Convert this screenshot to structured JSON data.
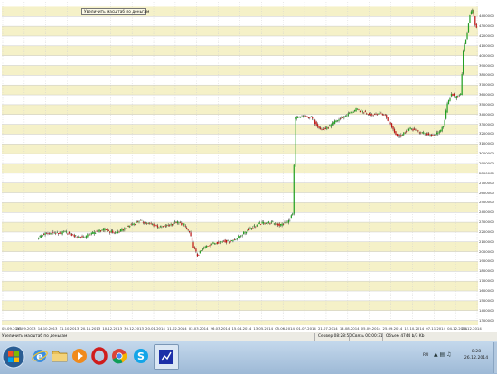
{
  "tooltip": {
    "text": "Увеличить масштаб по деньгам"
  },
  "statusbar": {
    "message": "Увеличить масштаб по деньгам",
    "server_label": "Сервер 08:28:50",
    "connection_label": "Связь 00:00:31",
    "volume_label": "Объем 4744 b/3 Kb"
  },
  "taskbar": {
    "start_icon": "windows-start-icon",
    "apps": [
      {
        "name": "ie-icon",
        "icon": "internet-explorer-icon"
      },
      {
        "name": "folder-icon",
        "icon": "file-explorer-icon"
      },
      {
        "name": "media-player-icon",
        "icon": "media-player-icon"
      },
      {
        "name": "opera-icon",
        "icon": "opera-browser-icon"
      },
      {
        "name": "chrome-icon",
        "icon": "chrome-browser-icon"
      },
      {
        "name": "skype-icon",
        "icon": "skype-icon"
      },
      {
        "name": "trading-terminal-icon",
        "icon": "trading-terminal-icon"
      }
    ],
    "lang": "RU",
    "clock_time": "8:28",
    "clock_date": "26.12.2014"
  },
  "chart_data": {
    "type": "candlestick",
    "title": "",
    "ylim": [
      1250000,
      4550000
    ],
    "y_ticks": [
      "4400000",
      "4300000",
      "4200000",
      "4100000",
      "4000000",
      "3900000",
      "3800000",
      "3700000",
      "3600000",
      "3500000",
      "3400000",
      "3300000",
      "3200000",
      "3100000",
      "3000000",
      "2900000",
      "2800000",
      "2700000",
      "2600000",
      "2500000",
      "2400000",
      "2300000",
      "2200000",
      "2100000",
      "2000000",
      "1900000",
      "1800000",
      "1700000",
      "1600000",
      "1500000",
      "1400000",
      "1300000"
    ],
    "x_ticks": [
      "05.09.2013",
      "26.09.2013",
      "14.10.2013",
      "31.10.2013",
      "20.11.2013",
      "10.12.2013",
      "30.12.2013",
      "20.01.2014",
      "11.02.2014",
      "03.03.2014",
      "26.03.2014",
      "15.04.2014",
      "13.05.2014",
      "05.06.2014",
      "01.07.2014",
      "21.07.2014",
      "14.08.2014",
      "05.09.2014",
      "25.09.2014",
      "15.10.2014",
      "07.11.2014",
      "04.12.2014",
      "26.12.2014"
    ],
    "grid": true,
    "candle_colors": {
      "up": "#22a022",
      "down": "#c01414"
    },
    "band_color": "#f5f1c8",
    "path": [
      [
        0,
        2148000
      ],
      [
        4,
        2180000
      ],
      [
        10,
        2190000
      ],
      [
        16,
        2185000
      ],
      [
        20,
        2200000
      ],
      [
        24,
        2178000
      ],
      [
        28,
        2156000
      ],
      [
        34,
        2150000
      ],
      [
        40,
        2186000
      ],
      [
        46,
        2215000
      ],
      [
        50,
        2228000
      ],
      [
        54,
        2205000
      ],
      [
        58,
        2192000
      ],
      [
        62,
        2215000
      ],
      [
        68,
        2260000
      ],
      [
        72,
        2290000
      ],
      [
        76,
        2314000
      ],
      [
        80,
        2300000
      ],
      [
        86,
        2276000
      ],
      [
        92,
        2250000
      ],
      [
        98,
        2268000
      ],
      [
        104,
        2300000
      ],
      [
        110,
        2275000
      ],
      [
        114,
        2195000
      ],
      [
        117,
        2050000
      ],
      [
        120,
        1960000
      ],
      [
        123,
        2010000
      ],
      [
        127,
        2060000
      ],
      [
        131,
        2080000
      ],
      [
        135,
        2095000
      ],
      [
        140,
        2110000
      ],
      [
        144,
        2100000
      ],
      [
        148,
        2125000
      ],
      [
        154,
        2180000
      ],
      [
        160,
        2240000
      ],
      [
        166,
        2282000
      ],
      [
        172,
        2300000
      ],
      [
        178,
        2292000
      ],
      [
        182,
        2270000
      ],
      [
        186,
        2290000
      ],
      [
        188,
        2300000
      ],
      [
        192,
        2385000
      ],
      [
        194,
        3360000
      ],
      [
        200,
        3382000
      ],
      [
        206,
        3370000
      ],
      [
        210,
        3300000
      ],
      [
        214,
        3245000
      ],
      [
        218,
        3258000
      ],
      [
        224,
        3328000
      ],
      [
        230,
        3372000
      ],
      [
        236,
        3420000
      ],
      [
        240,
        3448000
      ],
      [
        246,
        3425000
      ],
      [
        252,
        3395000
      ],
      [
        258,
        3418000
      ],
      [
        262,
        3390000
      ],
      [
        266,
        3300000
      ],
      [
        270,
        3195000
      ],
      [
        274,
        3180000
      ],
      [
        278,
        3240000
      ],
      [
        282,
        3255000
      ],
      [
        286,
        3230000
      ],
      [
        292,
        3205000
      ],
      [
        298,
        3185000
      ],
      [
        302,
        3210000
      ],
      [
        306,
        3280000
      ],
      [
        309,
        3500000
      ],
      [
        312,
        3620000
      ],
      [
        315,
        3570000
      ],
      [
        319,
        3600000
      ],
      [
        321,
        4050000
      ],
      [
        324,
        4240000
      ],
      [
        326,
        4420000
      ],
      [
        328,
        4460000
      ],
      [
        330,
        4320000
      ],
      [
        331,
        4280000
      ]
    ]
  }
}
